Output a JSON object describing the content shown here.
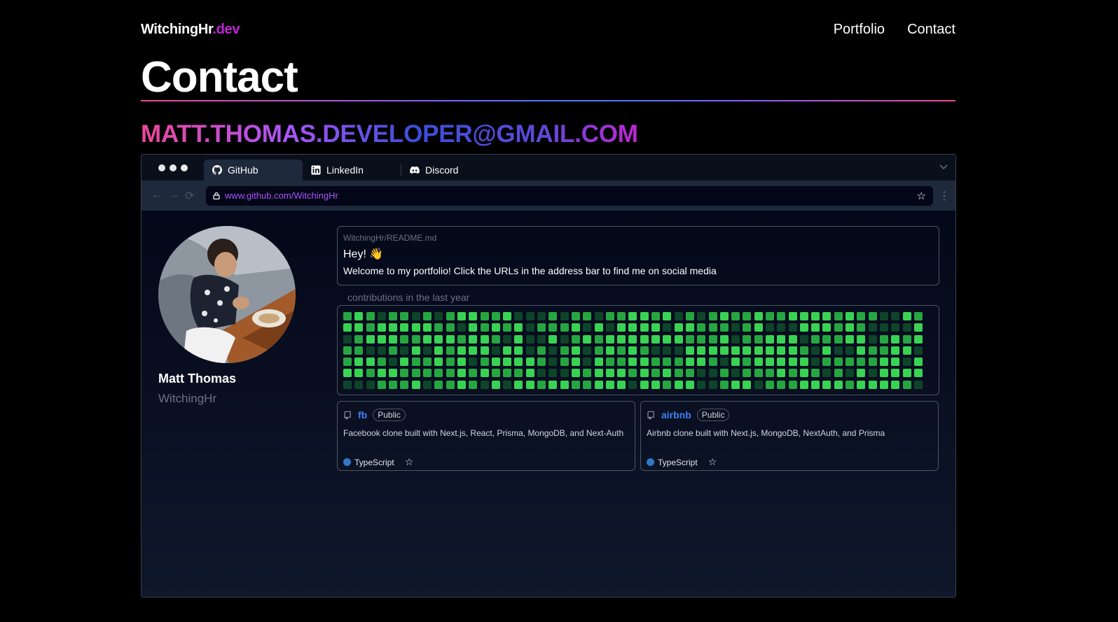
{
  "header": {
    "logo_main": "WitchingHr",
    "logo_tld": ".dev",
    "nav": [
      {
        "label": "Portfolio"
      },
      {
        "label": "Contact"
      }
    ]
  },
  "page": {
    "title": "Contact",
    "email": "MATT.THOMAS.DEVELOPER@GMAIL.COM"
  },
  "browser": {
    "tabs": [
      {
        "label": "GitHub",
        "icon": "github-icon",
        "active": true
      },
      {
        "label": "LinkedIn",
        "icon": "linkedin-icon",
        "active": false
      },
      {
        "label": "Discord",
        "icon": "discord-icon",
        "active": false
      }
    ],
    "url": "www.github.com/WitchingHr"
  },
  "profile": {
    "name": "Matt Thomas",
    "handle": "WitchingHr"
  },
  "readme": {
    "path": "WitchingHr/README.md",
    "greeting": "Hey! 👋",
    "text": "Welcome to my portfolio! Click the URLs in the address bar to find me on social media"
  },
  "contributions": {
    "label": "contributions in the last year",
    "colors": {
      "bright": "#39d353",
      "mid": "#26a641",
      "dark": "#0e4429"
    }
  },
  "repos": [
    {
      "name": "fb",
      "visibility": "Public",
      "description": "Facebook clone built with Next.js, React, Prisma, MongoDB, and Next-Auth",
      "language": "TypeScript",
      "language_color": "#3178c6"
    },
    {
      "name": "airbnb",
      "visibility": "Public",
      "description": "Airbnb clone built with Next.js, MongoDB, NextAuth, and Prisma",
      "language": "TypeScript",
      "language_color": "#3178c6"
    }
  ],
  "colors": {
    "accent_pink": "#ec4899",
    "accent_purple": "#a855f7",
    "accent_blue": "#3b82f6"
  }
}
